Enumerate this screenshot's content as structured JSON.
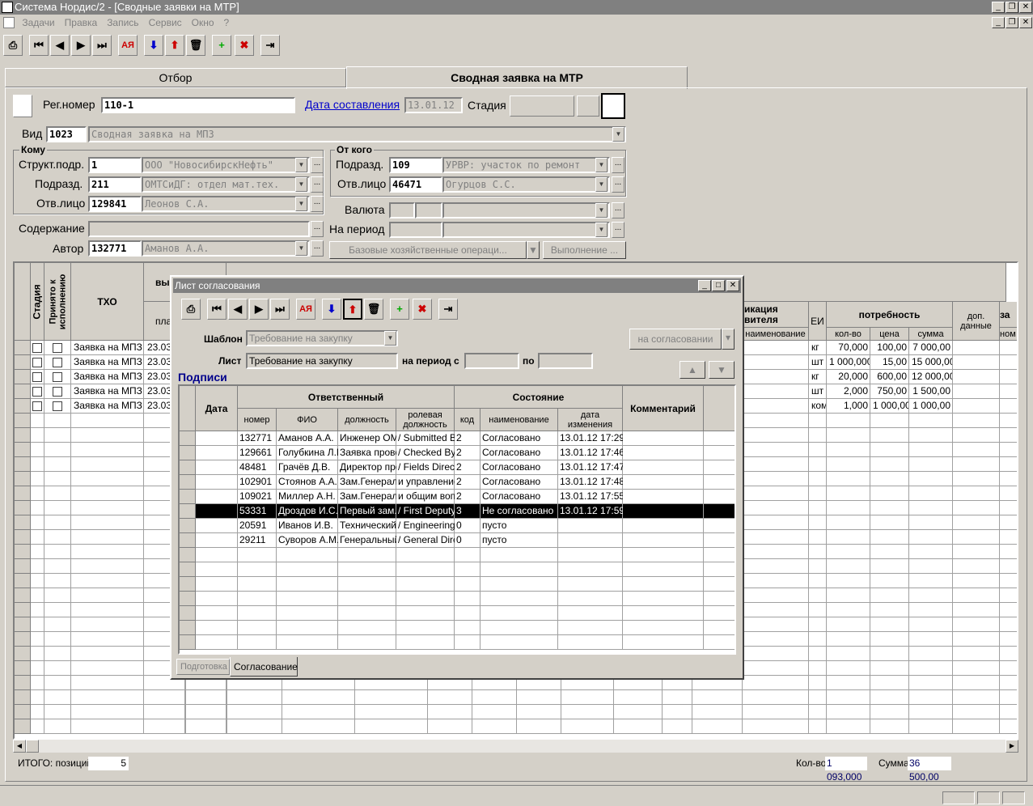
{
  "window": {
    "title": "Система Нордис/2 - [Сводные заявки на МТР]"
  },
  "menu": [
    "Задачи",
    "Правка",
    "Запись",
    "Сервис",
    "Окно",
    "?"
  ],
  "tabs": {
    "filter": "Отбор",
    "main": "Сводная заявка на МТР"
  },
  "header": {
    "reg_label": "Рег.номер",
    "reg_value": "110-1",
    "date_link": "Дата составления",
    "date_value": "13.01.12",
    "stage_label": "Стадия",
    "vid_label": "Вид",
    "vid_code": "1023",
    "vid_name": "Сводная заявка на МПЗ"
  },
  "komu": {
    "title": "Кому",
    "struct_label": "Структ.подр.",
    "struct_code": "1",
    "struct_name": "ООО \"НовосибирскНефть\"",
    "podr_label": "Подразд.",
    "podr_code": "211",
    "podr_name": "ОМТСиДГ: отдел мат.тех.",
    "otv_label": "Отв.лицо",
    "otv_code": "129841",
    "otv_name": "Леонов С.А."
  },
  "otkogo": {
    "title": "От кого",
    "podr_label": "Подразд.",
    "podr_code": "109",
    "podr_name": "УРВР: участок по ремонт",
    "otv_label": "Отв.лицо",
    "otv_code": "46471",
    "otv_name": "Огурцов С.С.",
    "val_label": "Валюта",
    "period_label": "На период"
  },
  "content_label": "Содержание",
  "author_label": "Автор",
  "author_code": "132771",
  "author_name": "Аманов А.А.",
  "btn_ops": "Базовые хозяйственные операци...",
  "btn_exec": "Выполнение ...",
  "main_grid": {
    "h_stage": "Стадия",
    "h_accepted": "Принято к исполнению",
    "h_txo": "ТХО",
    "h_vyp": "вы",
    "h_pla": "пла",
    "h_p": "п",
    "h_ikacia": "икация",
    "h_vitelya": "вителя",
    "h_naim": "наименование",
    "h_ei": "ЕИ",
    "h_potr": "потребность",
    "h_qty": "кол-во",
    "h_price": "цена",
    "h_sum": "сумма",
    "h_dop": "доп. данные",
    "h_za": "за",
    "h_nom": "ном",
    "rows": [
      {
        "txo": "Заявка на МПЗ",
        "date": "23.03",
        "ei": "кг",
        "qty": "70,000",
        "price": "100,00",
        "sum": "7 000,00"
      },
      {
        "txo": "Заявка на МПЗ",
        "date": "23.03",
        "ei": "шт",
        "qty": "1 000,000",
        "price": "15,00",
        "sum": "15 000,00"
      },
      {
        "txo": "Заявка на МПЗ",
        "date": "23.03",
        "ei": "кг",
        "qty": "20,000",
        "price": "600,00",
        "sum": "12 000,00"
      },
      {
        "txo": "Заявка на МПЗ",
        "date": "23.03",
        "ei": "шт",
        "qty": "2,000",
        "price": "750,00",
        "sum": "1 500,00"
      },
      {
        "txo": "Заявка на МПЗ",
        "date": "23.03",
        "ei": "ком",
        "qty": "1,000",
        "price": "1 000,00",
        "sum": "1 000,00"
      }
    ]
  },
  "footer": {
    "itogo_label": "ИТОГО: позиций",
    "itogo_value": "5",
    "qty_label": "Кол-во",
    "qty_value": "1 093,000",
    "sum_label": "Сумма",
    "sum_value": "36 500,00"
  },
  "dialog": {
    "title": "Лист согласования",
    "template_label": "Шаблон",
    "template_value": "Требование на закупку",
    "status_btn": "на согласовании",
    "list_label": "Лист",
    "list_value": "Требование на закупку",
    "period_from": "на период с",
    "period_to": "по",
    "signatures": "Подписи",
    "h_date": "Дата",
    "h_resp": "Ответственный",
    "h_state": "Состояние",
    "h_comment": "Комментарий",
    "h_num": "номер",
    "h_fio": "ФИО",
    "h_pos": "должность",
    "h_role": "ролевая должность",
    "h_code": "код",
    "h_name": "наименование",
    "h_changed": "дата изменения",
    "rows": [
      {
        "num": "132771",
        "fio": "Аманов А.А.",
        "pos": "Инженер ОМ",
        "role": "/ Submitted B",
        "code": "2",
        "state": "Согласовано",
        "changed": "13.01.12 17:29"
      },
      {
        "num": "129661",
        "fio": "Голубкина Л.Г",
        "pos": "Заявка прове",
        "role": "/ Checked By",
        "code": "2",
        "state": "Согласовано",
        "changed": "13.01.12 17:46"
      },
      {
        "num": "48481",
        "fio": "Грачёв Д.В.",
        "pos": "Директор про",
        "role": "/ Fields Direct",
        "code": "2",
        "state": "Согласовано",
        "changed": "13.01.12 17:47"
      },
      {
        "num": "102901",
        "fio": "Стоянов А.А.",
        "pos": "Зам.Генерал",
        "role": "и управление",
        "code": "2",
        "state": "Согласовано",
        "changed": "13.01.12 17:48"
      },
      {
        "num": "109021",
        "fio": "Миллер А.Н.",
        "pos": "Зам.Генерал",
        "role": "и общим воп",
        "code": "2",
        "state": "Согласовано",
        "changed": "13.01.12 17:55"
      },
      {
        "num": "53331",
        "fio": "Дроздов И.С.",
        "pos": "Первый зам.",
        "role": "/ First Deputy",
        "code": "3",
        "state": "Не согласовано",
        "changed": "13.01.12 17:59"
      },
      {
        "num": "20591",
        "fio": "Иванов И.В.",
        "pos": "Технический",
        "role": "/ Engineering",
        "code": "0",
        "state": "пусто",
        "changed": ""
      },
      {
        "num": "29211",
        "fio": "Суворов А.М.",
        "pos": "Генеральный",
        "role": "/ General Dire",
        "code": "0",
        "state": "пусто",
        "changed": ""
      }
    ],
    "tab_prep": "Подготовка",
    "tab_approve": "Согласование"
  }
}
